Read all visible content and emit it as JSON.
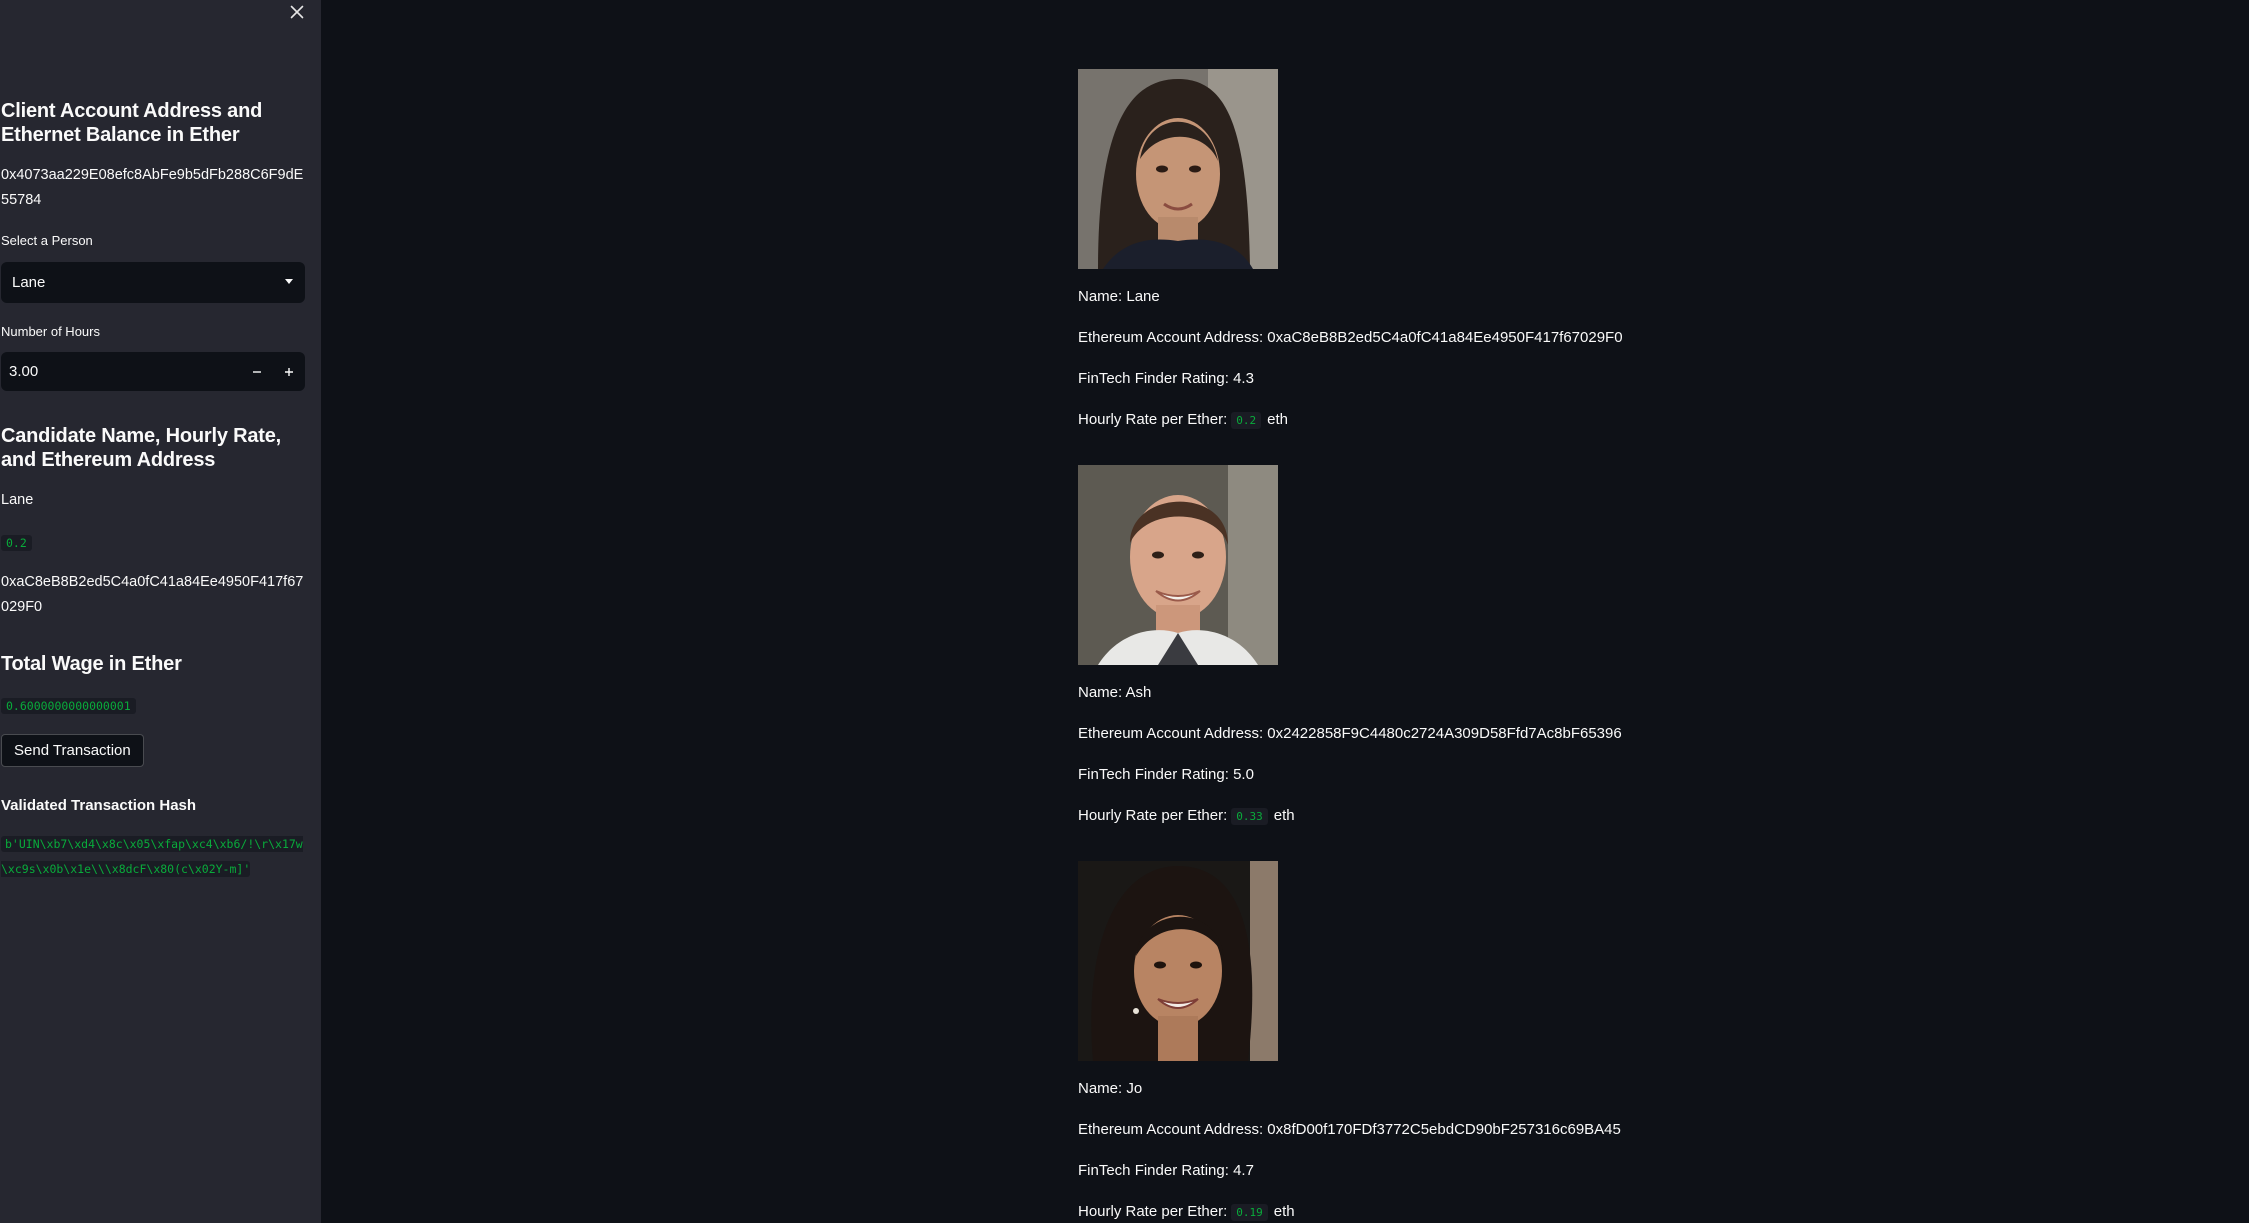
{
  "sidebar": {
    "client_heading": "Client Account Address and Ethernet Balance in Ether",
    "client_address": "0x4073aa229E08efc8AbFe9b5dFb288C6F9dE55784",
    "select_label": "Select a Person",
    "selected_person": "Lane",
    "hours_label": "Number of Hours",
    "hours_value": "3.00",
    "candidate_heading": "Candidate Name, Hourly Rate, and Ethereum Address",
    "candidate_name": "Lane",
    "candidate_rate": "0.2",
    "candidate_address": "0xaC8eB8B2ed5C4a0fC41a84Ee4950F417f67029F0",
    "wage_heading": "Total Wage in Ether",
    "wage_value": "0.6000000000000001",
    "send_button": "Send Transaction",
    "hash_label": "Validated Transaction Hash",
    "hash_value": "b'UIN\\xb7\\xd4\\x8c\\x05\\xfap\\xc4\\xb6/!\\r\\x17w\\xc9s\\x0b\\x1e\\\\\\x8dcF\\x80(c\\x02Y-m]'"
  },
  "candidates": [
    {
      "name_line": "Name: Lane",
      "address_line": "Ethereum Account Address: 0xaC8eB8B2ed5C4a0fC41a84Ee4950F417f67029F0",
      "rating_line": "FinTech Finder Rating: 4.3",
      "rate_prefix": "Hourly Rate per Ether:",
      "rate": "0.2",
      "rate_suffix": "eth"
    },
    {
      "name_line": "Name: Ash",
      "address_line": "Ethereum Account Address: 0x2422858F9C4480c2724A309D58Ffd7Ac8bF65396",
      "rating_line": "FinTech Finder Rating: 5.0",
      "rate_prefix": "Hourly Rate per Ether:",
      "rate": "0.33",
      "rate_suffix": "eth"
    },
    {
      "name_line": "Name: Jo",
      "address_line": "Ethereum Account Address: 0x8fD00f170FDf3772C5ebdCD90bF257316c69BA45",
      "rating_line": "FinTech Finder Rating: 4.7",
      "rate_prefix": "Hourly Rate per Ether:",
      "rate": "0.19",
      "rate_suffix": "eth"
    }
  ],
  "icons": {
    "close": "close-icon",
    "select_chevron": "chevron-down-icon",
    "decrement": "minus-icon",
    "increment": "plus-icon"
  },
  "colors": {
    "app_background": "#0e1117",
    "sidebar_background": "#262730",
    "code_text": "#09ab3b",
    "text": "#fafafa"
  }
}
